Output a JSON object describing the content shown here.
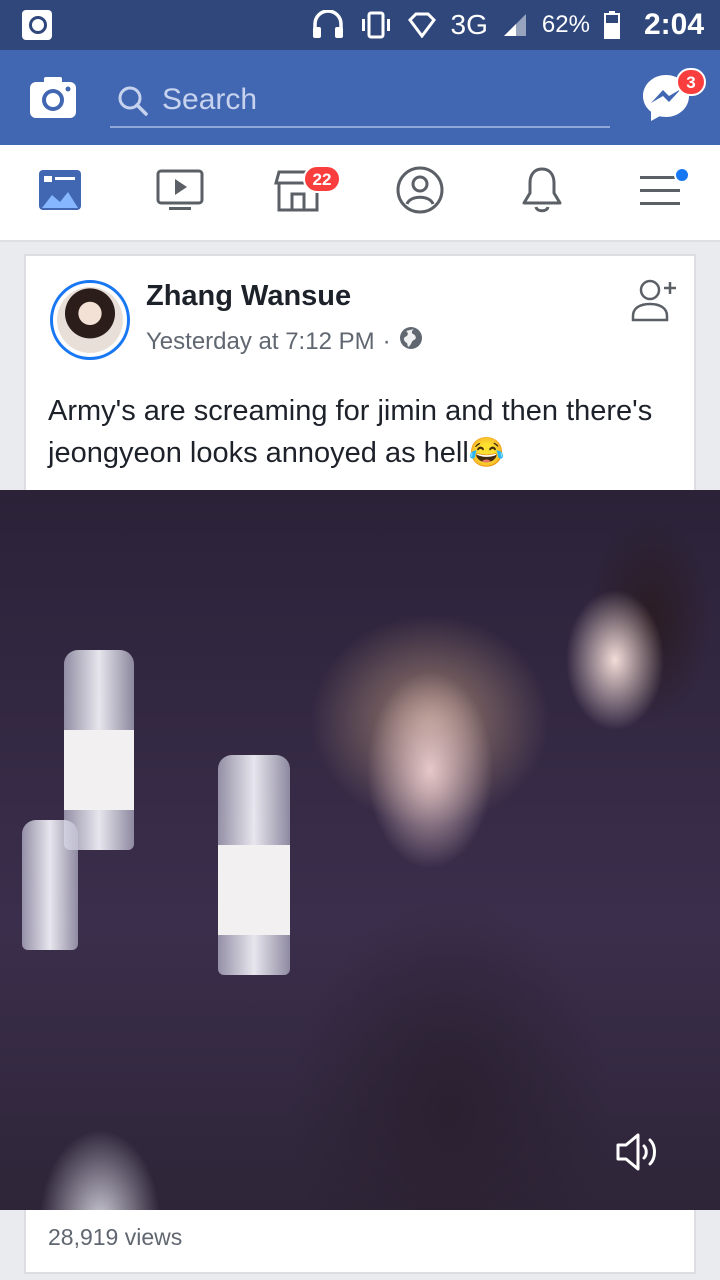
{
  "status_bar": {
    "network": "3G",
    "battery": "62%",
    "time": "2:04"
  },
  "header": {
    "search_placeholder": "Search",
    "messenger_badge": "3"
  },
  "nav": {
    "marketplace_badge": "22"
  },
  "post": {
    "author": "Zhang Wansue",
    "timestamp": "Yesterday at 7:12 PM",
    "separator": "·",
    "text": "Army's are screaming for jimin and then there's jeongyeon looks annoyed as hell😂",
    "views": "28,919 views"
  },
  "colors": {
    "brand_blue": "#4267b2",
    "status_bar": "#30477c",
    "badge_red": "#fa3e3e"
  },
  "icons": [
    "camera-icon",
    "search-icon",
    "messenger-icon",
    "news-feed-icon",
    "watch-icon",
    "marketplace-icon",
    "profile-icon",
    "notifications-icon",
    "menu-icon",
    "globe-icon",
    "add-friend-icon",
    "volume-icon"
  ]
}
